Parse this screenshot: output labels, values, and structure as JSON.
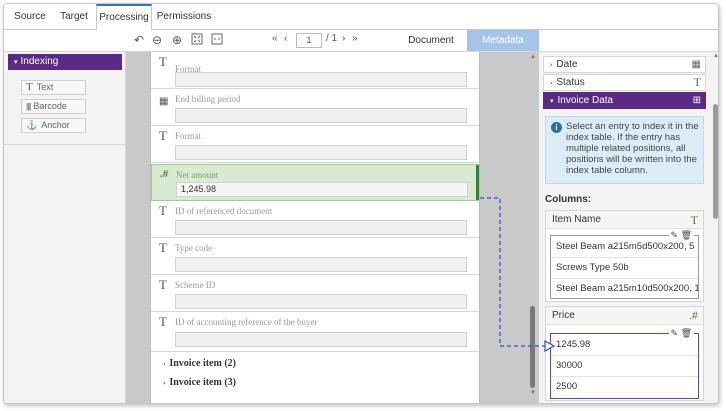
{
  "tabs": [
    "Source",
    "Target",
    "Processing",
    "Permissions"
  ],
  "toolbar": {
    "page_current": "1",
    "page_total": "/ 1",
    "doc_tab": "Document",
    "meta_tab": "Metadata"
  },
  "left": {
    "header": "Indexing",
    "tools": [
      "Text",
      "Barcode",
      "Anchor"
    ]
  },
  "fields": [
    {
      "label": "Format",
      "value": ""
    },
    {
      "label": "End billing period",
      "value": ""
    },
    {
      "label": "Format",
      "value": ""
    },
    {
      "label": "Net amount",
      "value": "1,245.98"
    },
    {
      "label": "ID of referenced document",
      "value": ""
    },
    {
      "label": "Type code",
      "value": ""
    },
    {
      "label": "Scheme ID",
      "value": ""
    },
    {
      "label": "ID of accounting reference of the buyer",
      "value": ""
    }
  ],
  "invoice_items": [
    "Invoice item (2)",
    "Invoice item (3)"
  ],
  "right": {
    "sections": [
      "Date",
      "Status",
      "Invoice Data"
    ],
    "info": "Select an entry to index it in the index table. If the entry has multiple related positions, all positions will be written into the index table column.",
    "columns_label": "Columns:",
    "item_name": {
      "title": "Item Name",
      "entries": [
        "Steel Beam a215m5d500x200, 5 ...",
        "Screws Type 50b",
        "Steel Beam a215m10d500x200, 1..."
      ]
    },
    "price": {
      "title": "Price",
      "entries": [
        "1245.98",
        "30000",
        "2500"
      ]
    }
  },
  "colors": {
    "accent": "#5b2a86",
    "highlight_green": "#d9ead3",
    "link_blue": "#2b4fc4",
    "metadata_tab": "#a6c4ea"
  }
}
